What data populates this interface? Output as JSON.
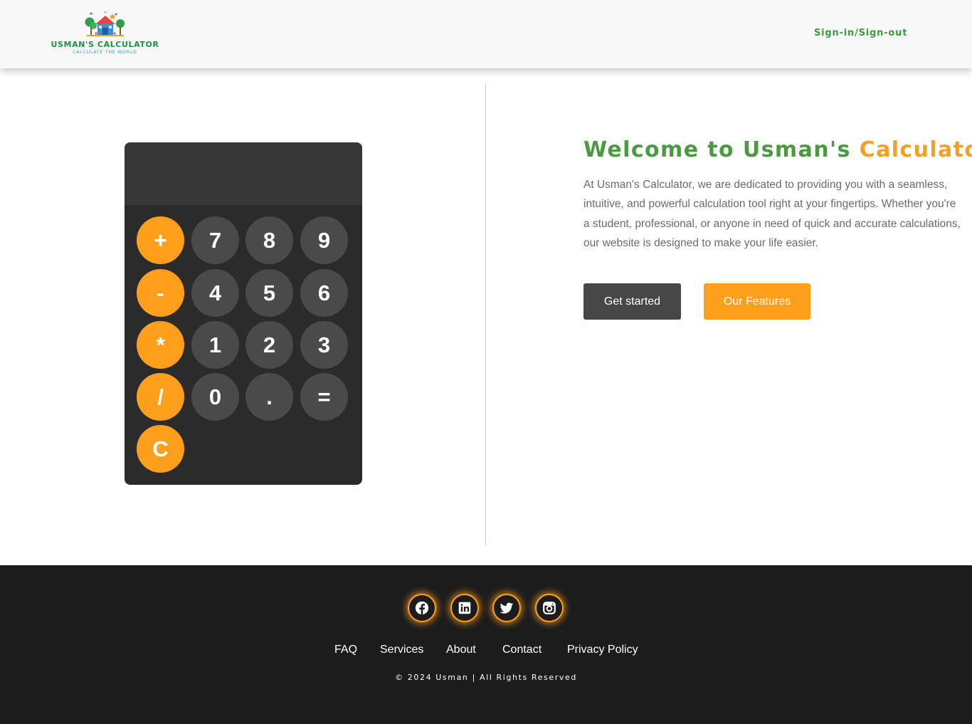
{
  "header": {
    "logo_title": "USMAN'S CALCULATOR",
    "logo_tagline": "CALCULATE THE WORLD",
    "signin_label": "Sign-in/Sign-out"
  },
  "calculator": {
    "display_value": "",
    "keys": {
      "plus": "+",
      "seven": "7",
      "eight": "8",
      "nine": "9",
      "minus": "-",
      "four": "4",
      "five": "5",
      "six": "6",
      "multiply": "*",
      "one": "1",
      "two": "2",
      "three": "3",
      "divide": "/",
      "zero": "0",
      "dot": ".",
      "equals": "=",
      "clear": "C"
    }
  },
  "hero": {
    "title_part1": "Welcome to Usman's ",
    "title_part2": "Calculator!",
    "paragraph": "At Usman's Calculator, we are dedicated to providing you with a seamless, intuitive, and powerful calculation tool right at your fingertips. Whether you're a student, professional, or anyone in need of quick and accurate calculations, our website is designed to make your life easier.",
    "get_started": "Get started",
    "our_features": "Our Features"
  },
  "footer": {
    "social_icons": [
      "facebook-icon",
      "linkedin-icon",
      "twitter-icon",
      "instagram-icon"
    ],
    "links": {
      "faq": "FAQ",
      "services": "Services",
      "about": "About",
      "contact": "Contact",
      "privacy": "Privacy Policy"
    },
    "copyright": "© 2024 Usman | All Rights Reserved"
  },
  "colors": {
    "accent_orange": "#ff9f1c",
    "brand_green": "#4a9b3f",
    "calculator_body": "#2b2b2b",
    "footer_bg": "#1c1c1c"
  }
}
